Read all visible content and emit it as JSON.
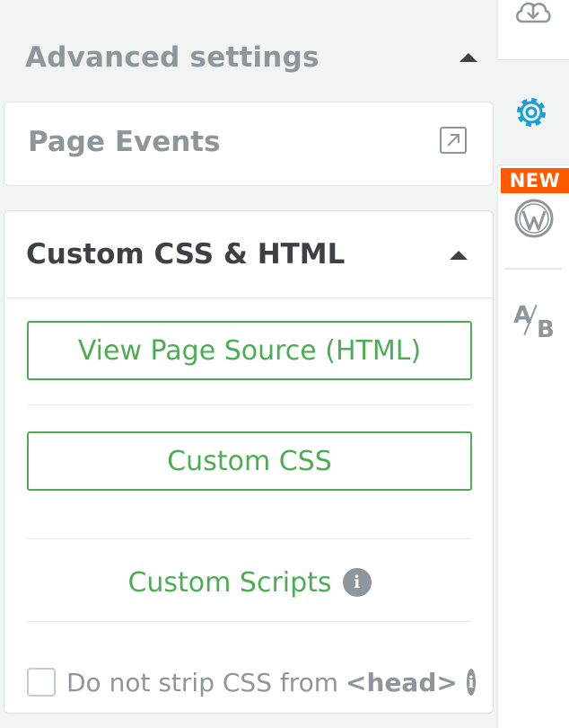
{
  "advanced_settings": {
    "title": "Advanced settings"
  },
  "page_events": {
    "title": "Page Events"
  },
  "custom_section": {
    "title": "Custom CSS & HTML",
    "view_source_label": "View Page Source (HTML)",
    "custom_css_label": "Custom CSS",
    "custom_scripts_label": "Custom Scripts",
    "strip_label": "Do not strip CSS from",
    "strip_code": "<head>"
  },
  "rail": {
    "new_badge": "NEW",
    "ab_a": "A",
    "ab_b": "B"
  },
  "colors": {
    "accent_green": "#4cad54",
    "active_blue": "#1a9ed9",
    "badge_orange": "#ff5a00",
    "muted_gray": "#8f969b",
    "dark_text": "#3d4146"
  },
  "icons": {
    "cloud": "cloud-download-icon",
    "gear": "gear-icon",
    "wordpress": "wordpress-icon",
    "ab": "ab-test-icon",
    "external": "external-link-icon",
    "info": "info-icon",
    "caret": "caret-up-icon"
  }
}
